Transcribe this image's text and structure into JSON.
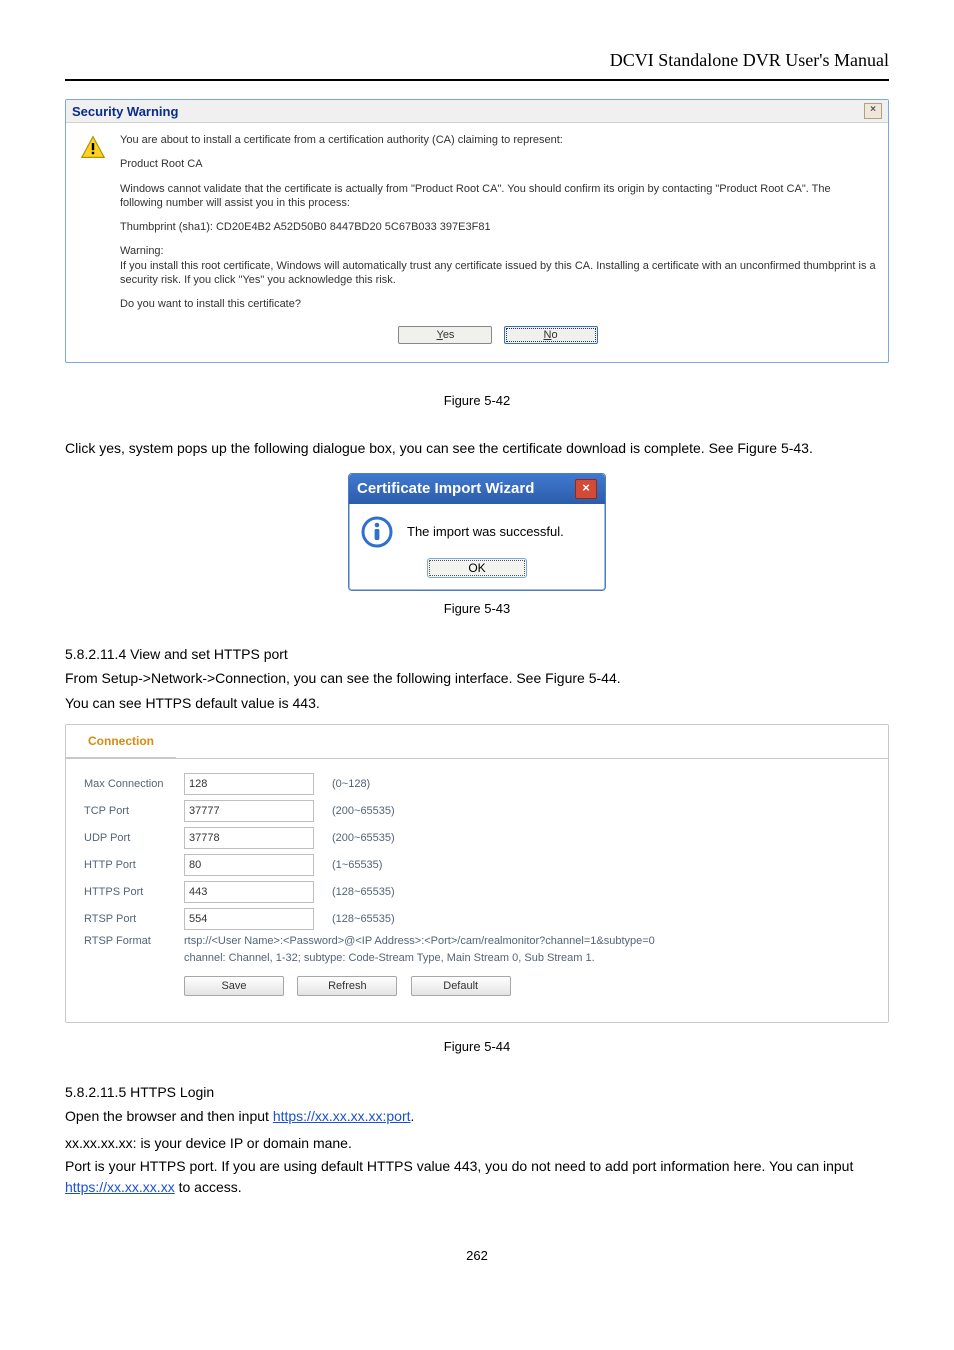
{
  "header": {
    "title": "DCVI Standalone DVR User's Manual"
  },
  "security_dialog": {
    "title": "Security Warning",
    "intro": "You are about to install a certificate from a certification authority (CA) claiming to represent:",
    "ca_name": "Product Root CA",
    "validate_line": "Windows cannot validate that the certificate is actually from \"Product Root CA\". You should confirm its origin by contacting \"Product Root CA\". The following number will assist you in this process:",
    "thumbprint": "Thumbprint (sha1): CD20E4B2 A52D50B0 8447BD20 5C67B033 397E3F81",
    "warning_head": "Warning:",
    "warning_body": "If you install this root certificate, Windows will automatically trust any certificate issued by this CA. Installing a certificate with an unconfirmed thumbprint is a security risk. If you click \"Yes\" you acknowledge this risk.",
    "question": "Do you want to install this certificate?",
    "yes_access": "Y",
    "yes_rest": "es",
    "no_access": "N",
    "no_rest": "o"
  },
  "fig1": "Figure 5-42",
  "click_yes_line": "Click yes, system pops up the following dialogue box, you can see the certificate download is complete. See Figure 5-43.",
  "import_dialog": {
    "title": "Certificate Import Wizard",
    "message": "The import was successful.",
    "ok_label": "OK"
  },
  "fig2": "Figure 5-43",
  "hport": {
    "heading": "5.8.2.11.4 View and set HTTPS port",
    "line1_pre": "From Setup->Network->Connection, you can see the following interface. See Figure 5-44.",
    "line2": "You can see HTTPS default value is 443."
  },
  "connection": {
    "tab": "Connection",
    "rows": {
      "max_conn": {
        "label": "Max Connection",
        "value": "128",
        "hint": "(0~128)"
      },
      "tcp": {
        "label": "TCP Port",
        "value": "37777",
        "hint": "(200~65535)"
      },
      "udp": {
        "label": "UDP Port",
        "value": "37778",
        "hint": "(200~65535)"
      },
      "http": {
        "label": "HTTP Port",
        "value": "80",
        "hint": "(1~65535)"
      },
      "https": {
        "label": "HTTPS Port",
        "value": "443",
        "hint": "(128~65535)"
      },
      "rtsp": {
        "label": "RTSP Port",
        "value": "554",
        "hint": "(128~65535)"
      }
    },
    "rtsp_format_label": "RTSP Format",
    "rtsp_format_value": "rtsp://<User Name>:<Password>@<IP Address>:<Port>/cam/realmonitor?channel=1&subtype=0",
    "rtsp_subline": "channel: Channel, 1-32; subtype: Code-Stream Type, Main Stream 0, Sub Stream 1.",
    "buttons": {
      "save": "Save",
      "refresh": "Refresh",
      "default": "Default"
    }
  },
  "fig3": "Figure 5-44",
  "login": {
    "heading": "5.8.2.11.5 HTTPS Login",
    "line_pre": "Open the browser and then input ",
    "url": "https://xx.xx.xx.xx:port",
    "line_post": ".",
    "xx": "xx.xx.xx.xx: is your device IP or domain mane.",
    "port": "Port is your HTTPS port. If you are using default HTTPS value 443, you do not need to add port information here. You can input ",
    "port_url": "https://xx.xx.xx.xx",
    "port_tail": " to access."
  },
  "page_number": "262"
}
